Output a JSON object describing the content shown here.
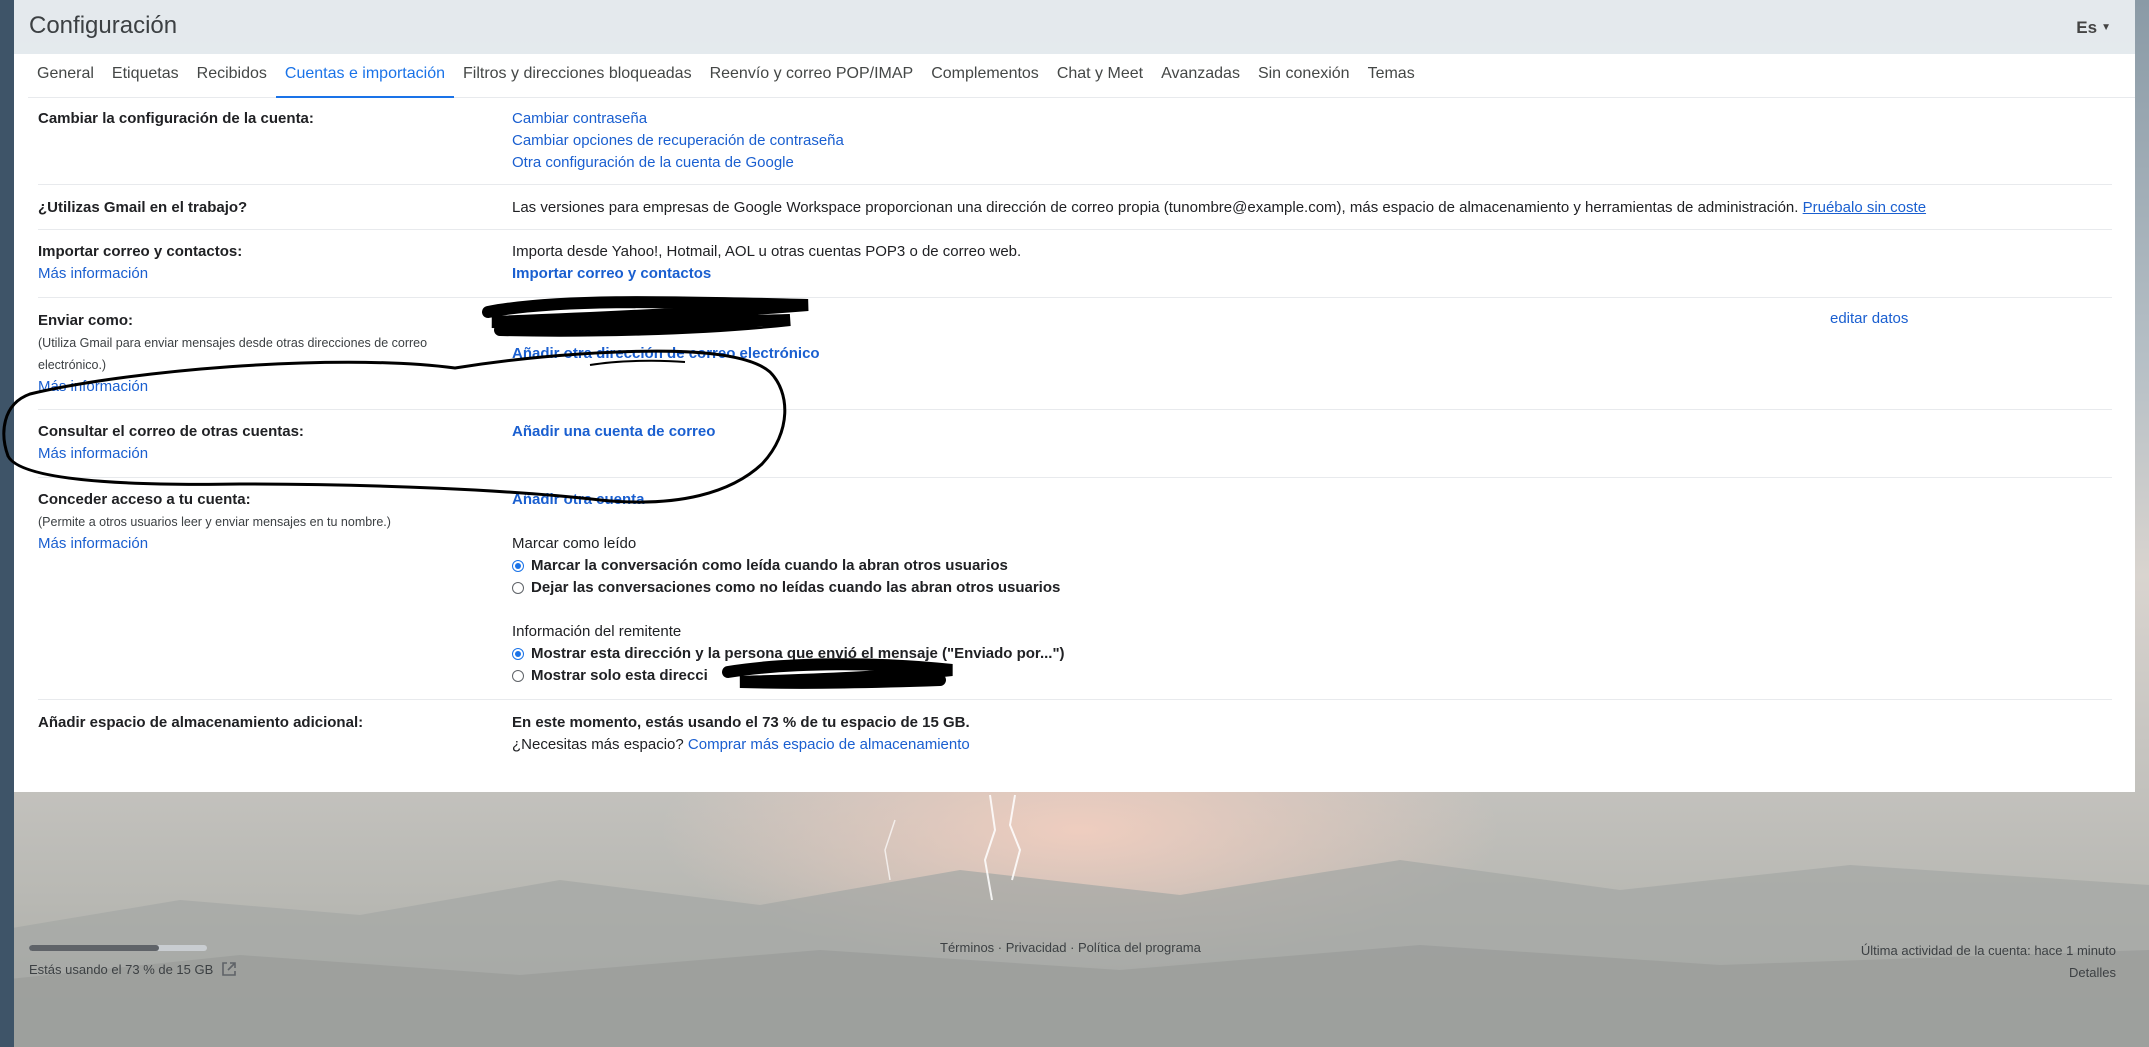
{
  "header": {
    "title": "Configuración",
    "language": "Es"
  },
  "tabs": [
    {
      "label": "General"
    },
    {
      "label": "Etiquetas"
    },
    {
      "label": "Recibidos"
    },
    {
      "label": "Cuentas e importación",
      "active": true
    },
    {
      "label": "Filtros y direcciones bloqueadas"
    },
    {
      "label": "Reenvío y correo POP/IMAP"
    },
    {
      "label": "Complementos"
    },
    {
      "label": "Chat y Meet"
    },
    {
      "label": "Avanzadas"
    },
    {
      "label": "Sin conexión"
    },
    {
      "label": "Temas"
    }
  ],
  "account": {
    "title": "Cambiar la configuración de la cuenta:",
    "links": [
      "Cambiar contraseña",
      "Cambiar opciones de recuperación de contraseña",
      "Otra configuración de la cuenta de Google"
    ]
  },
  "workspace": {
    "title": "¿Utilizas Gmail en el trabajo?",
    "text": "Las versiones para empresas de Google Workspace proporcionan una dirección de correo propia (tunombre@example.com), más espacio de almacenamiento y herramientas de administración.",
    "link": "Pruébalo sin coste"
  },
  "import": {
    "title": "Importar correo y contactos:",
    "more": "Más información",
    "text": "Importa desde Yahoo!, Hotmail, AOL u otras cuentas POP3 o de correo web.",
    "link": "Importar correo y contactos"
  },
  "send_as": {
    "title": "Enviar como:",
    "desc": "(Utiliza Gmail para enviar mensajes desde otras direcciones de correo electrónico.)",
    "more": "Más información",
    "add_link": "Añadir otra dirección de correo electrónico",
    "edit": "editar datos"
  },
  "check_mail": {
    "title": "Consultar el correo de otras cuentas:",
    "more": "Más información",
    "link": "Añadir una cuenta de correo"
  },
  "grant_access": {
    "title": "Conceder acceso a tu cuenta:",
    "desc": "(Permite a otros usuarios leer y enviar mensajes en tu nombre.)",
    "more": "Más información",
    "add_link": "Añadir otra cuenta",
    "mark_read_title": "Marcar como leído",
    "mark_read_options": [
      {
        "label": "Marcar la conversación como leída cuando la abran otros usuarios",
        "checked": true
      },
      {
        "label": "Dejar las conversaciones como no leídas cuando las abran otros usuarios",
        "checked": false
      }
    ],
    "sender_title": "Información del remitente",
    "sender_options": [
      {
        "label": "Mostrar esta dirección y la persona que envió el mensaje (\"Enviado por...\")",
        "checked": true
      },
      {
        "label": "Mostrar solo esta direcci",
        "checked": false
      }
    ]
  },
  "storage": {
    "title": "Añadir espacio de almacenamiento adicional:",
    "usage": "En este momento, estás usando el 73 % de tu espacio de 15 GB.",
    "need_more": "¿Necesitas más espacio?",
    "buy_link": "Comprar más espacio de almacenamiento"
  },
  "footer": {
    "storage_text": "Estás usando el 73 % de 15 GB",
    "storage_fraction": 0.73,
    "links": [
      "Términos",
      "Privacidad",
      "Política del programa"
    ],
    "separator": " · ",
    "last_activity": "Última actividad de la cuenta: hace 1 minuto",
    "details": "Detalles"
  },
  "colors": {
    "accent": "#1a73e8",
    "link": "#1a5fd0",
    "annotation_ink": "#000000"
  }
}
